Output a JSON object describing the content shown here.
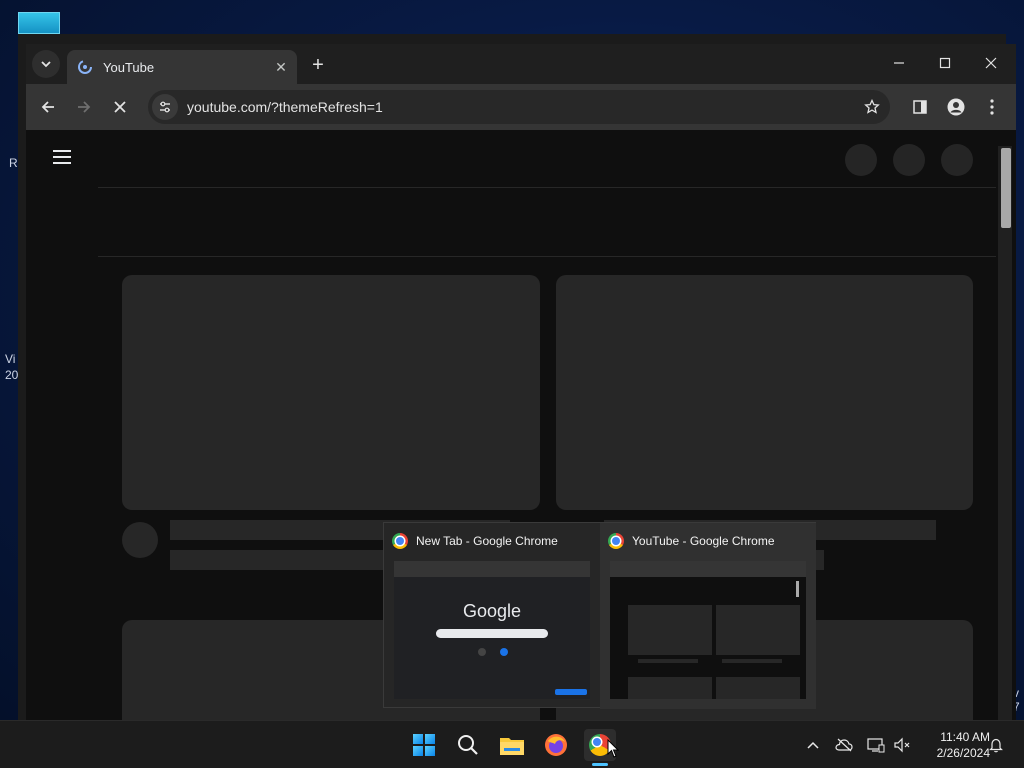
{
  "desktop": {
    "fragments": [
      "R",
      "Vi",
      "20",
      "v",
      "7"
    ]
  },
  "browser": {
    "tab": {
      "title": "YouTube"
    },
    "new_tab_symbol": "+",
    "address_bar": {
      "url": "youtube.com/?themeRefresh=1"
    },
    "window_controls": {
      "minimize": "—",
      "maximize": "☐",
      "close": "✕"
    }
  },
  "taskbar_preview": {
    "items": [
      {
        "title": "New Tab - Google Chrome",
        "mini_logo": "Google"
      },
      {
        "title": "YouTube - Google Chrome"
      }
    ]
  },
  "taskbar": {
    "icons": [
      "start-icon",
      "search-icon",
      "file-explorer-icon",
      "firefox-icon",
      "chrome-icon"
    ],
    "time": "11:40 AM",
    "date": "2/26/2024"
  },
  "colors": {
    "accent": "#4cc2ff",
    "chrome_dark": "#1f1f1f",
    "skeleton": "#272727"
  }
}
